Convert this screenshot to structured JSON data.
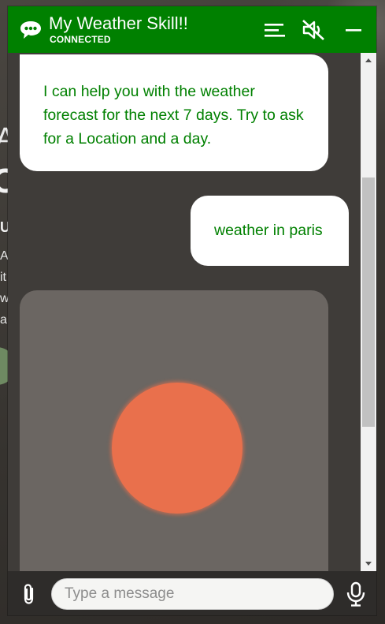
{
  "background": {
    "fragments": [
      "A",
      "C",
      "U",
      "A",
      "it",
      "w",
      "a"
    ]
  },
  "header": {
    "title": "My Weather Skill!!",
    "status": "CONNECTED",
    "menu_icon": "menu-icon",
    "mute_icon": "speaker-muted-icon",
    "minimize_icon": "minimize-icon",
    "logo_icon": "chat-bubble-icon"
  },
  "messages": [
    {
      "sender": "bot",
      "text": "I can help you with the weather forecast for the next 7 days. Try to ask for a Location and a day."
    },
    {
      "sender": "user",
      "text": "weather in paris"
    },
    {
      "sender": "bot",
      "type": "card",
      "icon": "sun-icon"
    }
  ],
  "composer": {
    "placeholder": "Type a message",
    "value": "",
    "attach_icon": "paperclip-icon",
    "mic_icon": "microphone-icon"
  },
  "colors": {
    "brand": "#008000",
    "sun": "#e9704c",
    "card": "#6b6662"
  }
}
